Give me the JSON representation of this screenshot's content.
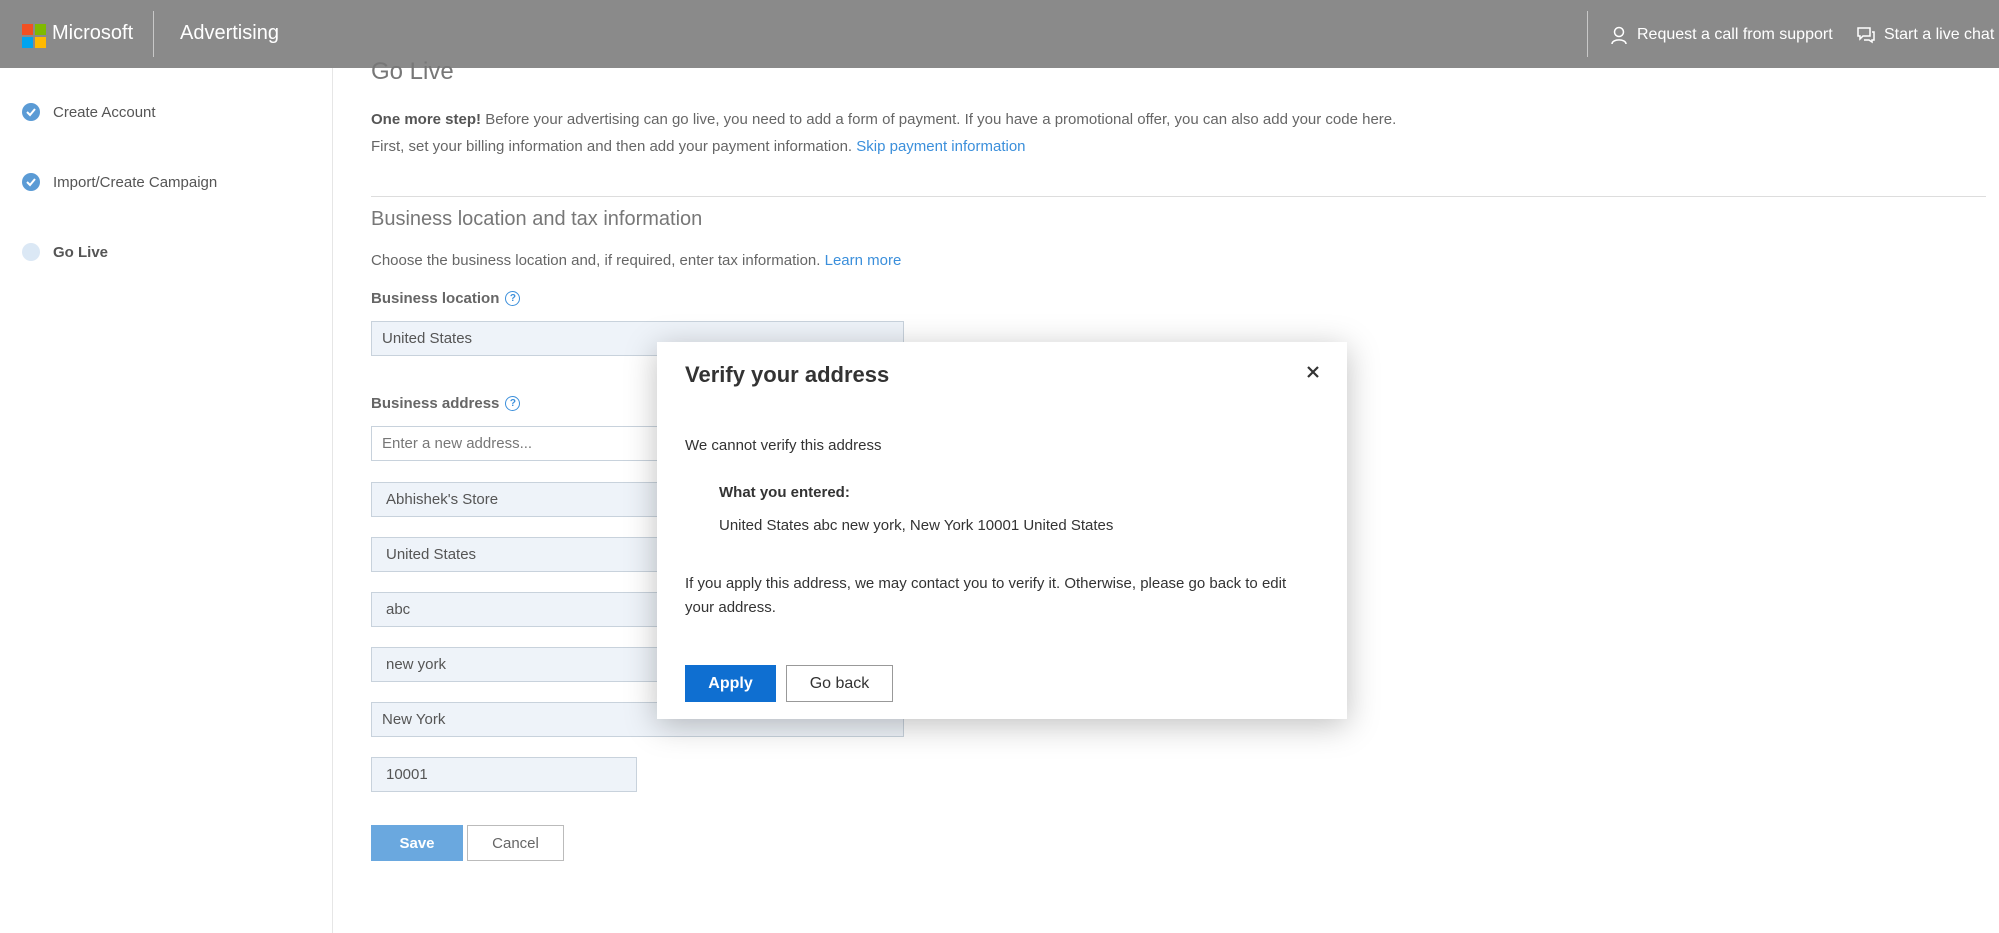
{
  "header": {
    "brand": "Microsoft",
    "product": "Advertising",
    "support_link": "Request a call from support",
    "chat_link": "Start a live chat",
    "logo_colors": [
      "#f25022",
      "#7fba00",
      "#00a4ef",
      "#ffb900"
    ]
  },
  "steps": [
    {
      "label": "Create Account",
      "status": "done"
    },
    {
      "label": "Import/Create Campaign",
      "status": "done"
    },
    {
      "label": "Go Live",
      "status": "current"
    }
  ],
  "page": {
    "title": "Go Live",
    "intro_bold": "One more step!",
    "intro_text": " Before your advertising can go live, you need to add a form of payment. If you have a promotional offer, you can also add your code here.",
    "intro_line2": "First, set your billing information and then add your payment information. ",
    "skip_link": "Skip payment information",
    "section_title": "Business location and tax information",
    "section_desc": "Choose the business location and, if required, enter tax information. ",
    "learn_more": "Learn more",
    "business_location_label": "Business location",
    "business_location_value": "United States",
    "business_address_label": "Business address",
    "address_search_placeholder": "Enter a new address...",
    "address_fields": [
      "Abhishek's Store",
      "United States",
      "abc",
      "new york",
      "New York",
      "10001"
    ],
    "save_label": "Save",
    "cancel_label": "Cancel"
  },
  "modal": {
    "title": "Verify your address",
    "close_icon": "close-icon",
    "message": "We cannot verify this address",
    "entered_label": "What you entered:",
    "entered_value": "United States abc new york, New York 10001 United States",
    "note": "If you apply this address, we may contact you to verify it. Otherwise, please go back to edit your address.",
    "apply_label": "Apply",
    "goback_label": "Go back"
  },
  "colors": {
    "header_bg": "#8a8a8a",
    "accent": "#0f6fd1",
    "link": "#3b8fdb"
  }
}
